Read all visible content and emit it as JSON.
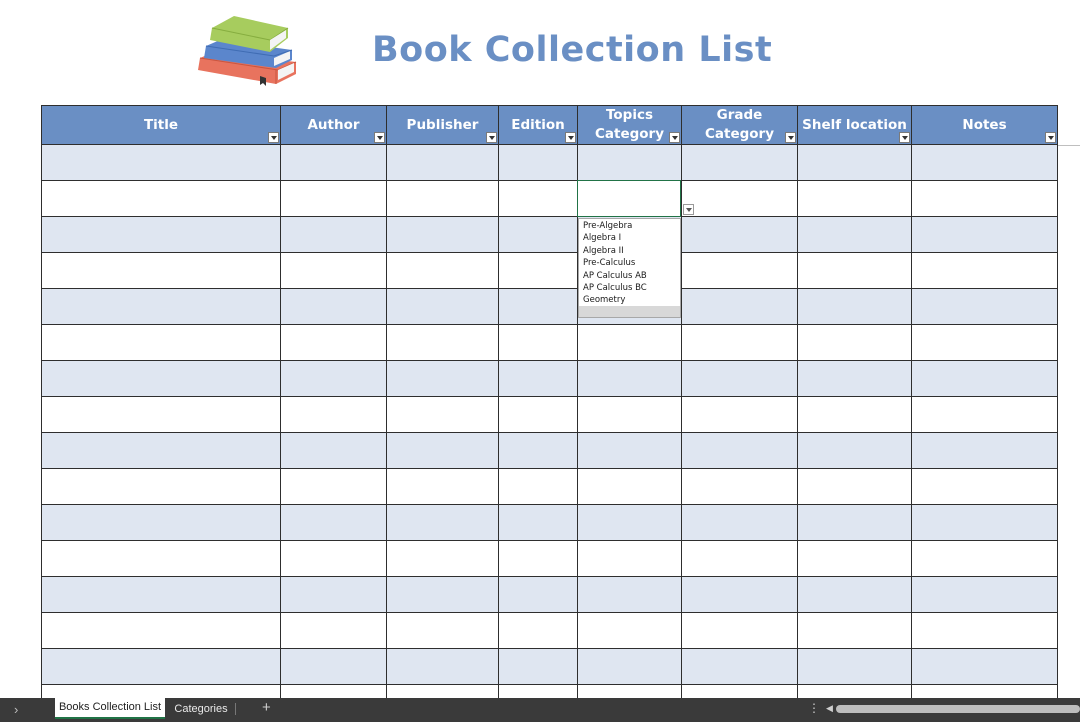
{
  "title": "Book Collection List",
  "columns": [
    "Title",
    "Author",
    "Publisher",
    "Edition",
    "Topics Category",
    "Grade Category",
    "Shelf location",
    "Notes"
  ],
  "dropdown": {
    "options": [
      "Pre-Algebra",
      "Algebra I",
      "Algebra II",
      "Pre-Calculus",
      "AP Calculus AB",
      "AP Calculus BC",
      "Geometry"
    ]
  },
  "sheet_tabs": {
    "active": "Books Collection List",
    "other": "Categories",
    "add": "+"
  },
  "colors": {
    "header": "#6a8fc4",
    "band": "#dfe6f1",
    "title": "#6a8fc4",
    "selection": "#217346"
  },
  "icons": {
    "logo": "books-stack-icon",
    "filter": "filter-dropdown-icon",
    "dropdown": "chevron-down-icon"
  }
}
